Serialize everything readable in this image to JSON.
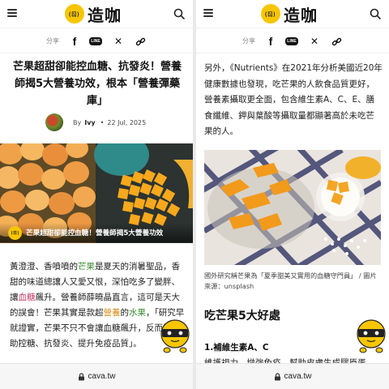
{
  "brand": {
    "logo_text": "造咖",
    "logo_face": "(ㄖ)",
    "accent": "#f7c600"
  },
  "share": {
    "label": "分享",
    "icons": [
      "facebook-icon",
      "line-icon",
      "x-icon",
      "link-icon"
    ],
    "line_text": "LINE"
  },
  "article": {
    "title": "芒果超甜卻能控血糖、抗發炎！營養師揭5大營養功效，根本「營養彈藥庫」",
    "by_label": "By",
    "author": "Ivy",
    "dot": "•",
    "date": "22 Jul, 2025",
    "hero_banner": "芒果超甜卻能控血糖！營養師揭5大營養功效"
  },
  "left_body": {
    "p1_a": "黃澄澄、香噴噴的",
    "p1_mango": "芒果",
    "p1_b": "是夏天的消暑聖品，香甜的味道總讓人又愛又恨，深怕吃多了變胖、讓",
    "p1_blood": "血糖",
    "p1_c": "飆升。營養師薛曉晶直言，這可是天大的誤會！芒果其實是款超",
    "p1_nutri": "營養",
    "p1_d": "的",
    "p1_fruit": "水果",
    "p1_e": "，「研究早就證實，芒果不只不會讓血糖飆升，反而能幫助控糖、抗發炎、提升免疫品質」。"
  },
  "right_body": {
    "para": "另外，《Nutrients》在2021年分析美國近20年健康數據也發現，吃芒果的人飲食品質更好，營養素攝取更全面，包含維生素A、C、E、膳食纖維、鉀與葉酸等攝取量都顯著高於未吃芒果的人。",
    "caption": "國外研究稱芒果為「夏季甜美又實用的血糖守門員」 / 圖片來源：unsplash",
    "h2": "吃芒果5大好處",
    "h3": "1.補維生素A、C",
    "cut_text": "維護視力、增強免疫、幫助皮膚生成膠原蛋"
  },
  "footer": {
    "url": "cava.tw"
  }
}
